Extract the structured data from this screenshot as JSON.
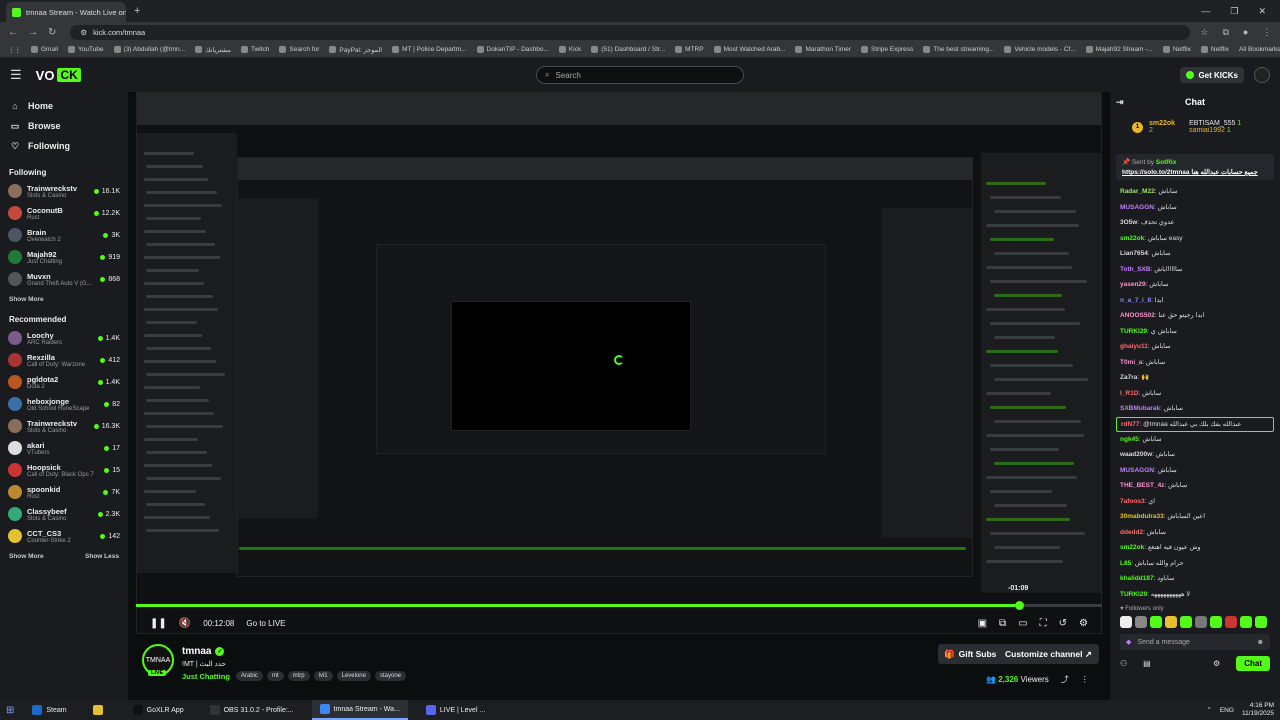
{
  "browser": {
    "tab_title": "tmnaa Stream - Watch Live on Kick",
    "url": "kick.com/tmnaa",
    "bookmarks": [
      "Gmail",
      "YouTube",
      "(3) Abdullah (@tmn...",
      "مشترياتك",
      "Twitch",
      "Search for",
      "PayPal: الموجز",
      "MT | Police Departm...",
      "DokanTIP - Dashbo...",
      "Kick",
      "(51) Dashboard / Str...",
      "MTRP",
      "Most Watched Arab...",
      "Marathon Timer",
      "Stripe Express",
      "The best streaming...",
      "Vehicle models - Cf...",
      "Majah92 Stream -...",
      "Netflix",
      "Netflix"
    ],
    "all_bookmarks": "All Bookmarks",
    "colors": {
      "accent": "#53fc18"
    }
  },
  "topbar": {
    "search_placeholder": "Search",
    "get_kicks": "Get KICKs"
  },
  "sidebar": {
    "nav": [
      {
        "label": "Home",
        "icon": "home-icon"
      },
      {
        "label": "Browse",
        "icon": "browse-icon"
      },
      {
        "label": "Following",
        "icon": "heart-icon"
      }
    ],
    "following_title": "Following",
    "following": [
      {
        "name": "Trainwreckstv",
        "game": "Slots & Casino",
        "viewers": "16.1K",
        "color": "#8a6d5b"
      },
      {
        "name": "CoconutB",
        "game": "Rust",
        "viewers": "12.2K",
        "color": "#c44b3b"
      },
      {
        "name": "Brain",
        "game": "Overwatch 2",
        "viewers": "3K",
        "color": "#4b5563"
      },
      {
        "name": "Majah92",
        "game": "Just Chatting",
        "viewers": "919",
        "color": "#1f7a3a"
      },
      {
        "name": "Muvxn",
        "game": "Grand Theft Auto V (G...",
        "viewers": "868",
        "color": "#555"
      }
    ],
    "show_more": "Show More",
    "recommended_title": "Recommended",
    "recommended": [
      {
        "name": "Loochy",
        "game": "ARC Raiders",
        "viewers": "1.4K",
        "color": "#7a5b8a"
      },
      {
        "name": "Rexzilla",
        "game": "Call of Duty: Warzone",
        "viewers": "412",
        "color": "#a33"
      },
      {
        "name": "pgldota2",
        "game": "Dota 2",
        "viewers": "1.4K",
        "color": "#b52"
      },
      {
        "name": "heboxjonge",
        "game": "Old School RuneScape",
        "viewers": "82",
        "color": "#3a6ea5"
      },
      {
        "name": "Trainwreckstv",
        "game": "Slots & Casino",
        "viewers": "16.3K",
        "color": "#8a6d5b"
      },
      {
        "name": "akari",
        "game": "VTubers",
        "viewers": "17",
        "color": "#ddd"
      },
      {
        "name": "Hoopsick",
        "game": "Call of Duty: Black Ops 7",
        "viewers": "15",
        "color": "#c33"
      },
      {
        "name": "spoonkid",
        "game": "Rust",
        "viewers": "7K",
        "color": "#b83"
      },
      {
        "name": "Classybeef",
        "game": "Slots & Casino",
        "viewers": "2.3K",
        "color": "#3a7"
      },
      {
        "name": "CCT_CS3",
        "game": "Counter-Strike 2",
        "viewers": "142",
        "color": "#e5c030"
      }
    ],
    "show_more_2": "Show More",
    "show_less": "Show Less"
  },
  "player": {
    "time": "00:12:08",
    "go_live": "Go to LIVE",
    "hover_time": "-01:09",
    "progress": 0.91
  },
  "channel": {
    "name": "tmnaa",
    "avatar_text": "TMNAA",
    "live": "LIVE",
    "title": "!MT | حدد البث",
    "category": "Just Chatting",
    "tags": [
      "Arabic",
      "mt",
      "mtrp",
      "lvl1",
      "Levelone",
      "stayone"
    ],
    "gift_subs": "Gift Subs",
    "customize": "Customize channel",
    "viewers": "2,326",
    "viewers_label": "Viewers"
  },
  "chat": {
    "title": "Chat",
    "gifters": [
      {
        "name": "sm22ok",
        "count": "2"
      },
      {
        "name": "EBTISAM_555",
        "count": "1"
      },
      {
        "name": "samiai1992",
        "count": "1"
      }
    ],
    "pinned_by_label": "Sent by",
    "pinned_by": "SotRix",
    "pinned_link": "https://solo.to/2tmnaa",
    "pinned_text": "جميع حسابات عبدالله هنا",
    "messages": [
      {
        "user": "Radar_M22",
        "text": "ساباش",
        "color": "#9be564"
      },
      {
        "user": "MUSAGGN",
        "text": "ساباش",
        "color": "#c47dff"
      },
      {
        "user": "3O5w",
        "text": "عدوي تحذف",
        "color": "#d8d8d8"
      },
      {
        "user": "sm22ok",
        "text": "ساباش easy",
        "color": "#53fc18"
      },
      {
        "user": "Lian7654",
        "text": "ساباش",
        "color": "#d8d8d8"
      },
      {
        "user": "Toth_SXB",
        "text": "سااااااباش",
        "color": "#c47dff"
      },
      {
        "user": "yasen29",
        "text": "ساباش",
        "color": "#ff8fd1"
      },
      {
        "user": "n_a_7_i_8",
        "text": "ابدا",
        "color": "#8a8cff"
      },
      {
        "user": "ANOOS502",
        "text": "ابدا رجيتو حق عنا",
        "color": "#ff8fd1"
      },
      {
        "user": "TURKI29",
        "text": "ساباش ي",
        "color": "#53fc18"
      },
      {
        "user": "ghaiyu11",
        "text": "ساباش",
        "color": "#ff6b6b"
      },
      {
        "user": "T0mi_a",
        "text": "ساباش",
        "color": "#ff8fd1"
      },
      {
        "user": "Za7ra",
        "text": "🙌",
        "color": "#d8d8d8"
      },
      {
        "user": "I_R1D",
        "text": "ساباش",
        "color": "#ff6b6b"
      },
      {
        "user": "SXBMubarak",
        "text": "ساباش",
        "color": "#c47dff"
      },
      {
        "user": "rdN77",
        "text": "@tmnaa عبدالله بفك بلك بي عبدالله",
        "color": "#ff6b6b",
        "highlight": true
      },
      {
        "user": "ngk45",
        "text": "ساباش",
        "color": "#53fc18"
      },
      {
        "user": "waad200w",
        "text": "ساباش",
        "color": "#d8d8d8"
      },
      {
        "user": "MUSAGGN",
        "text": "ساباش",
        "color": "#c47dff"
      },
      {
        "user": "THE_BEST_4z",
        "text": "ساباش",
        "color": "#ff8fd1"
      },
      {
        "user": "7afoos3",
        "text": "اي",
        "color": "#ff6b6b"
      },
      {
        "user": "30mabdulra33",
        "text": "اعين الساباش",
        "color": "#e5c030"
      },
      {
        "user": "ddedd2",
        "text": "ساباش",
        "color": "#ff6b6b"
      },
      {
        "user": "sm22ok",
        "text": "وش عيون فيه اهنغع",
        "color": "#53fc18"
      },
      {
        "user": "L85",
        "text": "حرام والله ساباش",
        "color": "#53fc18"
      },
      {
        "user": "khalidd187",
        "text": "ساباود",
        "color": "#53fc18"
      },
      {
        "user": "TURKI29",
        "text": "لا ههههههههههه",
        "color": "#53fc18"
      }
    ],
    "followers_only": "Followers only",
    "send_placeholder": "Send a message",
    "chat_button": "Chat"
  },
  "taskbar": {
    "items": [
      "Steam",
      "",
      "GoXLR App",
      "OBS 31.0.2 - Profile:...",
      "tmnaa Stream - Wa...",
      "LIVE | Level ..."
    ],
    "time": "4:16 PM",
    "date": "11/19/2025"
  }
}
